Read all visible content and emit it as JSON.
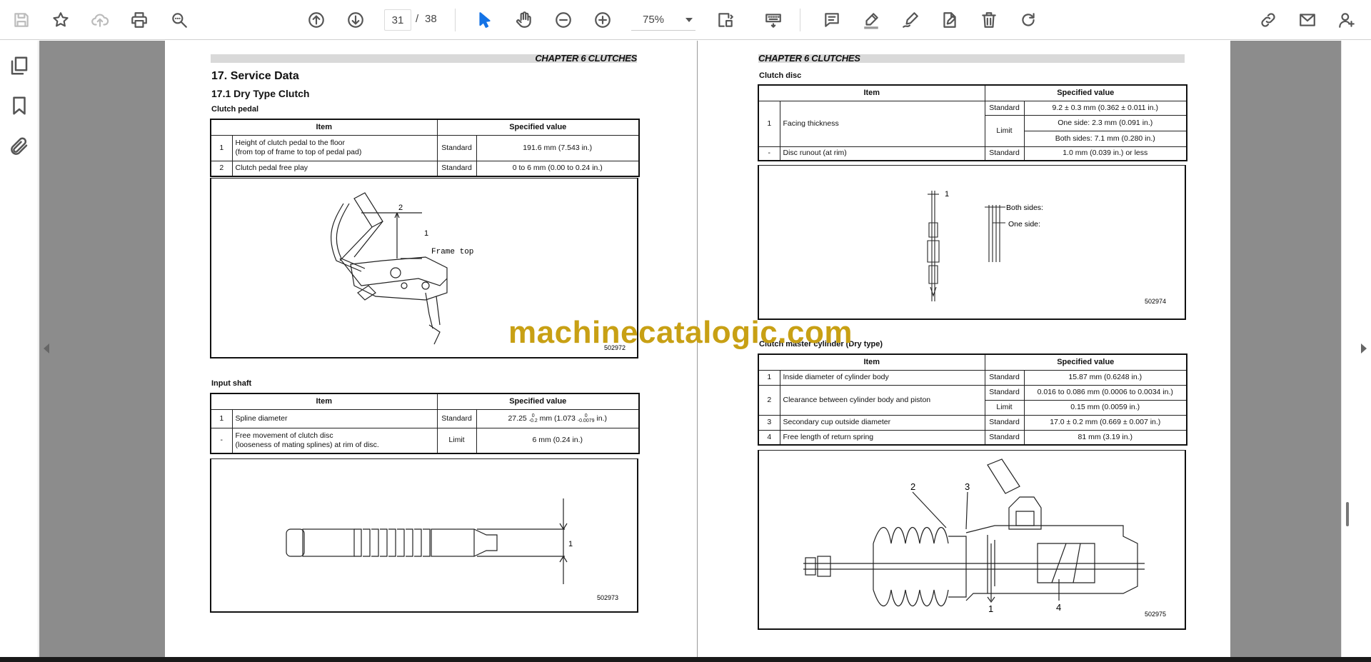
{
  "toolbar": {
    "page_current": "31",
    "page_separator": "/",
    "page_total": "38",
    "zoom": "75%"
  },
  "left_page": {
    "chapter": "CHAPTER 6 CLUTCHES",
    "section_title": "17.  Service Data",
    "subsection_title": "17.1    Dry Type Clutch",
    "clutch_pedal": {
      "heading": "Clutch pedal",
      "header_item": "Item",
      "header_value": "Specified value",
      "rows": [
        {
          "no": "1",
          "item_line1": "Height of clutch pedal to the floor",
          "item_line2": "(from top of frame to top of pedal pad)",
          "type": "Standard",
          "value": "191.6 mm (7.543 in.)"
        },
        {
          "no": "2",
          "item_line1": "Clutch pedal free play",
          "item_line2": "",
          "type": "Standard",
          "value": "0 to 6 mm (0.00 to 0.24 in.)"
        }
      ],
      "figure_labels": {
        "label_1": "1",
        "label_2": "2",
        "frame_top": "Frame top"
      },
      "figure_number": "502972"
    },
    "input_shaft": {
      "heading": "Input shaft",
      "header_item": "Item",
      "header_value": "Specified value",
      "rows": [
        {
          "no": "1",
          "item_line1": "Spline diameter",
          "item_line2": "",
          "type": "Standard",
          "value_main": "27.25",
          "tol1_upper": "0",
          "tol1_lower": "-0.2",
          "value_mid": " mm (1.073 ",
          "tol2_upper": "0",
          "tol2_lower": "-0.0079",
          "value_end": " in.)"
        },
        {
          "no": "-",
          "item_line1": "Free movement of clutch disc",
          "item_line2": "(looseness of mating splines) at rim of disc.",
          "type": "Limit",
          "value": "6 mm (0.24 in.)"
        }
      ],
      "figure_labels": {
        "label_1": "1"
      },
      "figure_number": "502973"
    }
  },
  "right_page": {
    "chapter": "CHAPTER 6 CLUTCHES",
    "clutch_disc": {
      "heading": "Clutch disc",
      "header_item": "Item",
      "header_value": "Specified value",
      "row1": {
        "no": "1",
        "item": "Facing thickness",
        "type_standard": "Standard",
        "value_standard": "9.2 ± 0.3 mm (0.362 ± 0.011 in.)",
        "type_limit": "Limit",
        "value_limit_one": "One side: 2.3 mm (0.091 in.)",
        "value_limit_both": "Both sides: 7.1 mm (0.280 in.)"
      },
      "row2": {
        "no": "-",
        "item": "Disc runout (at rim)",
        "type": "Standard",
        "value": "1.0 mm (0.039 in.) or less"
      },
      "figure_labels": {
        "label_1": "1",
        "both_sides": "Both sides:",
        "one_side": "One side:"
      },
      "figure_number": "502974"
    },
    "master_cylinder": {
      "heading": "Clutch master cylinder (Dry type)",
      "header_item": "Item",
      "header_value": "Specified value",
      "rows": [
        {
          "no": "1",
          "item": "Inside diameter of cylinder body",
          "type": "Standard",
          "value": "15.87 mm (0.6248 in.)"
        },
        {
          "no": "2",
          "item": "Clearance between cylinder body and piston",
          "type": "Standard",
          "value": "0.016 to 0.086 mm (0.0006 to 0.0034 in.)",
          "type2": "Limit",
          "value2": "0.15 mm (0.0059 in.)"
        },
        {
          "no": "3",
          "item": "Secondary cup outside diameter",
          "type": "Standard",
          "value": "17.0 ± 0.2 mm (0.669 ± 0.007 in.)"
        },
        {
          "no": "4",
          "item": "Free length of return spring",
          "type": "Standard",
          "value": "81 mm (3.19 in.)"
        }
      ],
      "figure_labels": {
        "label_1": "1",
        "label_2": "2",
        "label_3": "3",
        "label_4": "4"
      },
      "figure_number": "502975"
    }
  },
  "watermark": "machinecatalogic.com"
}
